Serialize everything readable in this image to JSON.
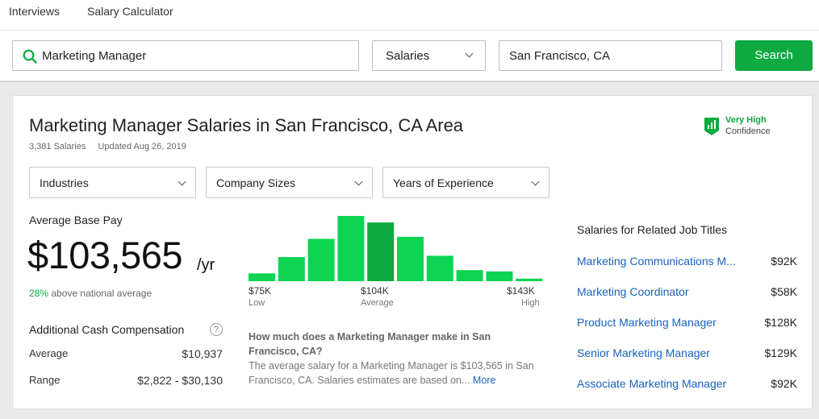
{
  "nav": {
    "items": [
      "Interviews",
      "Salary Calculator"
    ]
  },
  "search": {
    "query": "Marketing Manager",
    "type": "Salaries",
    "location": "San Francisco, CA",
    "button": "Search"
  },
  "header": {
    "title": "Marketing Manager Salaries in San Francisco, CA Area",
    "count": "3,381 Salaries",
    "updated": "Updated Aug 26, 2019",
    "confidence_level": "Very High",
    "confidence_label": "Confidence"
  },
  "filters": [
    "Industries",
    "Company Sizes",
    "Years of Experience"
  ],
  "pay": {
    "label": "Average Base Pay",
    "value": "$103,565",
    "unit": "/yr",
    "national_pct": "28%",
    "national_text": "above national average"
  },
  "cash": {
    "title": "Additional Cash Compensation",
    "help": "?",
    "average_label": "Average",
    "average_value": "$10,937",
    "range_label": "Range",
    "range_value": "$2,822 - $30,130"
  },
  "distribution": {
    "relative_heights": [
      0.12,
      0.37,
      0.65,
      1.0,
      0.9,
      0.68,
      0.39,
      0.17,
      0.15,
      0.04
    ],
    "highlight_index": 4,
    "colors": {
      "bar": "#0ed453",
      "highlight": "#0caa41"
    },
    "low_value": "$75K",
    "low_label": "Low",
    "avg_value": "$104K",
    "avg_label": "Average",
    "high_value": "$143K",
    "high_label": "High"
  },
  "faq": {
    "question": "How much does a Marketing Manager make in San Francisco, CA?",
    "answer": "The average salary for a Marketing Manager is $103,565 in San Francisco, CA. Salaries estimates are based on...",
    "more": "More"
  },
  "related": {
    "title": "Salaries for Related Job Titles",
    "items": [
      {
        "title": "Marketing Communications M...",
        "salary": "$92K"
      },
      {
        "title": "Marketing Coordinator",
        "salary": "$58K"
      },
      {
        "title": "Product Marketing Manager",
        "salary": "$128K"
      },
      {
        "title": "Senior Marketing Manager",
        "salary": "$129K"
      },
      {
        "title": "Associate Marketing Manager",
        "salary": "$92K"
      }
    ]
  },
  "colors": {
    "accent": "#0caa41",
    "link": "#1861bf"
  },
  "icons": {
    "search": "search-icon",
    "confidence": "bar-chart-badge-icon",
    "help": "help-icon",
    "dropdown": "chevron-down-icon"
  }
}
